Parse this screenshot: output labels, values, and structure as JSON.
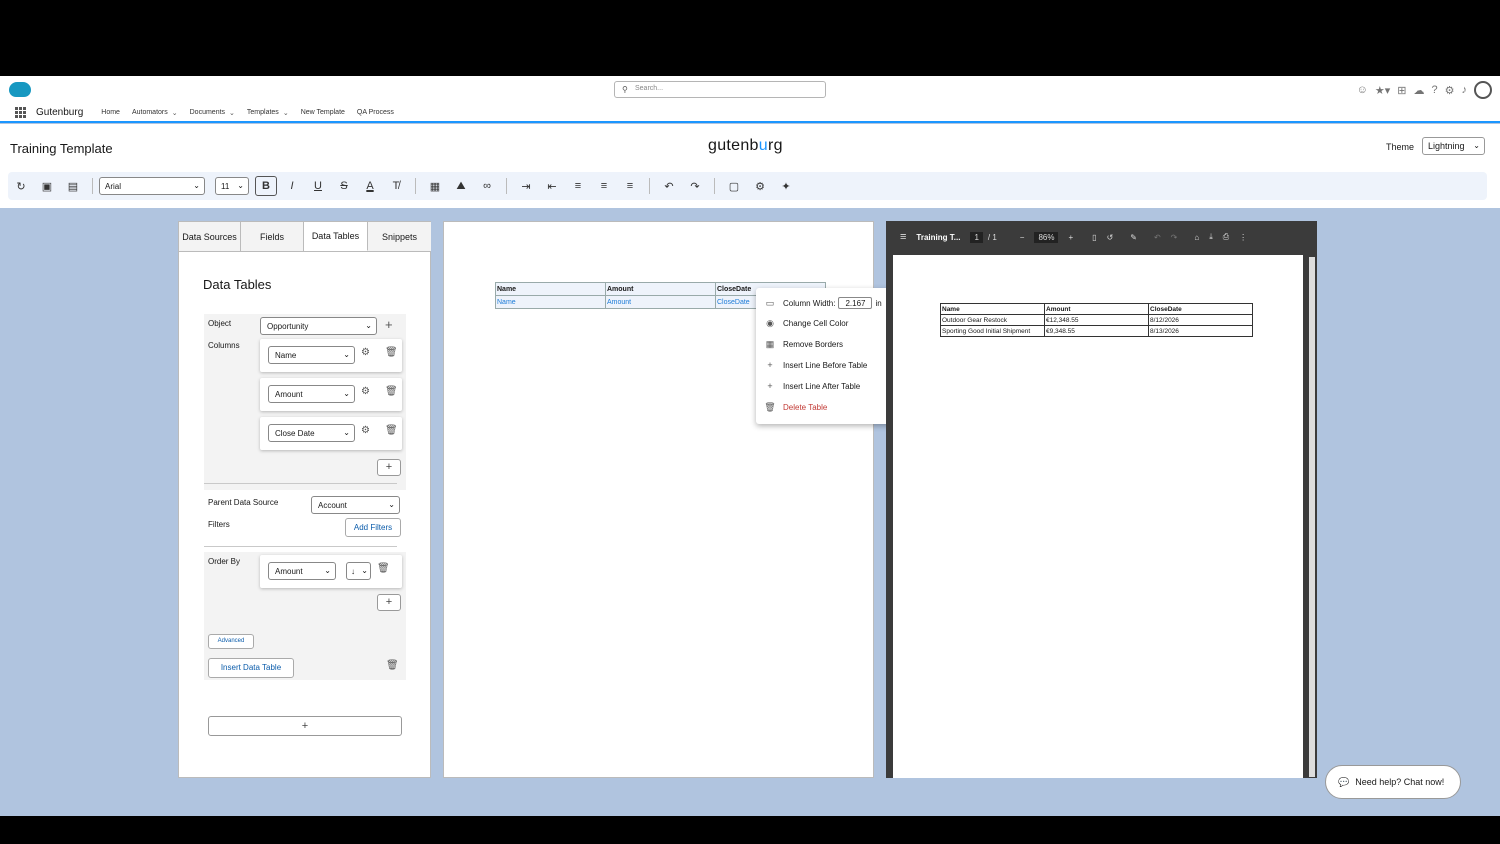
{
  "search": {
    "placeholder": "Search..."
  },
  "nav": {
    "app_name": "Gutenburg",
    "items": [
      {
        "label": "Home",
        "has_menu": false
      },
      {
        "label": "Automators",
        "has_menu": true
      },
      {
        "label": "Documents",
        "has_menu": true
      },
      {
        "label": "Templates",
        "has_menu": true
      },
      {
        "label": "New Template",
        "has_menu": false
      },
      {
        "label": "QA Process",
        "has_menu": false
      }
    ]
  },
  "header": {
    "title": "Training Template",
    "brand_prefix": "gutenb",
    "brand_accent": "u",
    "brand_suffix": "rg",
    "theme_label": "Theme",
    "theme_value": "Lightning"
  },
  "toolbar": {
    "font": "Arial",
    "size": "11"
  },
  "tabs": [
    "Data Sources",
    "Fields",
    "Data Tables",
    "Snippets"
  ],
  "data_tables": {
    "title": "Data Tables",
    "object_label": "Object",
    "object_value": "Opportunity",
    "columns_label": "Columns",
    "columns": [
      "Name",
      "Amount",
      "Close Date"
    ],
    "parent_label": "Parent Data Source",
    "parent_value": "Account",
    "filters_label": "Filters",
    "add_filters": "Add Filters",
    "order_by_label": "Order By",
    "order_by_value": "Amount",
    "order_dir": "↓",
    "advanced": "Advanced",
    "insert": "Insert Data Table"
  },
  "doc_table": {
    "headers": [
      "Name",
      "Amount",
      "CloseDate"
    ],
    "fields": [
      "Name",
      "Amount",
      "CloseDate"
    ]
  },
  "context_menu": {
    "column_width_label": "Column Width:",
    "column_width_value": "2.167",
    "column_width_unit": "in",
    "change_color": "Change Cell Color",
    "remove_borders": "Remove Borders",
    "insert_before": "Insert Line Before Table",
    "insert_after": "Insert Line After Table",
    "delete": "Delete Table"
  },
  "pdf": {
    "title": "Training T...",
    "page": "1",
    "total": "/  1",
    "zoom": "86%",
    "headers": [
      "Name",
      "Amount",
      "CloseDate"
    ],
    "rows": [
      [
        "Outdoor Gear Restock",
        "€12,348.55",
        "8/12/2026"
      ],
      [
        "Sporting Good Initial Shipment",
        "€9,348.55",
        "8/13/2026"
      ]
    ]
  },
  "chat": {
    "label": "Need help? Chat now!"
  },
  "colors": {
    "accent": "#1b96ff",
    "background": "#b0c4df",
    "danger": "#c23934",
    "link": "#0b5cab"
  }
}
